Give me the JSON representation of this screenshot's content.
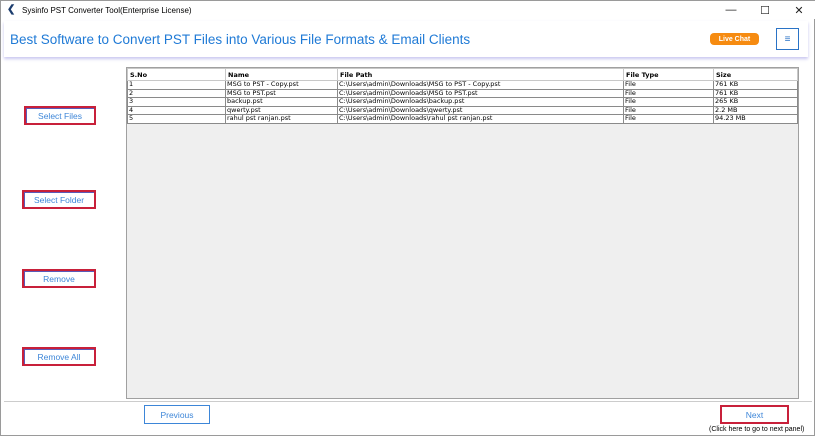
{
  "window": {
    "title": "Sysinfo PST Converter Tool(Enterprise License)",
    "minimize": "—",
    "maximize": "☐",
    "close": "✕"
  },
  "header": {
    "headline": "Best Software to Convert PST Files into Various File Formats & Email Clients",
    "live_chat": "Live Chat",
    "menu_icon": "≡"
  },
  "sidebar": {
    "select_files": "Select Files",
    "select_folder": "Select Folder",
    "remove": "Remove",
    "remove_all": "Remove All"
  },
  "table": {
    "columns": [
      "S.No",
      "Name",
      "File Path",
      "File Type",
      "Size"
    ],
    "rows": [
      [
        "1",
        "MSG to PST - Copy.pst",
        "C:\\Users\\admin\\Downloads\\MSG to PST - Copy.pst",
        "File",
        "761 KB"
      ],
      [
        "2",
        "MSG to PST.pst",
        "C:\\Users\\admin\\Downloads\\MSG to PST.pst",
        "File",
        "761 KB"
      ],
      [
        "3",
        "backup.pst",
        "C:\\Users\\admin\\Downloads\\backup.pst",
        "File",
        "265 KB"
      ],
      [
        "4",
        "qwerty.pst",
        "C:\\Users\\admin\\Downloads\\qwerty.pst",
        "File",
        "2.2 MB"
      ],
      [
        "5",
        "rahul pst ranjan.pst",
        "C:\\Users\\admin\\Downloads\\rahul pst ranjan.pst",
        "File",
        "94.23 MB"
      ]
    ]
  },
  "footer": {
    "previous": "Previous",
    "next": "Next",
    "next_hint": "(Click here to go to next panel)"
  }
}
